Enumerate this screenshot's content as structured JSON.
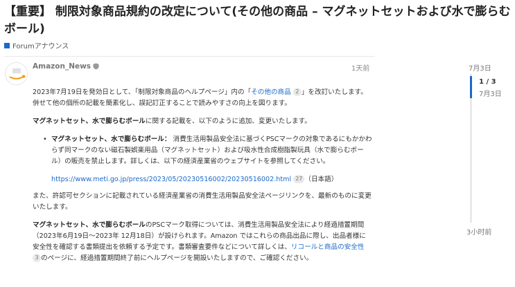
{
  "topic": {
    "title": "【重要】 制限対象商品規約の改定について(その他の商品 – マグネットセットおよび水で膨らむボール)",
    "category": "Forumアナウンス"
  },
  "post": {
    "author": "Amazon_News",
    "date": "1天前",
    "p1": {
      "a": "2023年7月19日を発効日として、「制限対象商品のヘルプページ」内の「",
      "link": "その他の商品",
      "badge": "2",
      "b": "」を改訂いたします。併せて他の個所の記載を簡素化し、誤記訂正することで読みやすさの向上を図ります。"
    },
    "p2": {
      "bold": "マグネットセット、水で膨らむボール",
      "rest": "に関する記載を、以下のように追加、変更いたします。"
    },
    "bullet": {
      "bold": "マグネットセット、水で膨らむボール：",
      "rest": " 消費生活用製品安全法に基づくPSCマークの対象であるにもかかわらず同マークのない磁石製娯楽用品（マグネットセット）および吸水性合成樹脂製玩具（水で膨らむボール）の販売を禁止します。詳しくは、以下の経済産業省のウェブサイトを参照してください。"
    },
    "meti": {
      "url": "https://www.meti.go.jp/press/2023/05/20230516002/20230516002.html",
      "badge": "27",
      "suffix": "（日本語）"
    },
    "p3": "また、許認可セクションに記載されている経済産業省の消費生活用製品安全法ページリンクを、最新のものに変更いたします。",
    "p4": {
      "bold": "マグネットセット、水で膨らむボール",
      "a": "のPSCマーク取得については、消費生活用製品安全法により経過措置期間（2023年6月19日～2023年 12月18日）が設けられます。Amazon ではこれらの商品出品に際し、出品者様に安全性を確認する書類提出を依頼する予定です。書類審査要件などについて詳しくは、",
      "link": "リコールと商品の安全性",
      "badge": "3",
      "b": "のページに、経過措置期間終了前にヘルプページを開設いたしますので、ご確認ください。"
    }
  },
  "timeline": {
    "top_date": "7月3日",
    "count": "1 / 3",
    "handle_date": "7月3日",
    "bottom_label": "3小时前"
  },
  "colors": {
    "accent": "#1b6ac9",
    "text": "#222222",
    "muted": "#777777"
  },
  "icons": {
    "moderator": "shield-icon",
    "category": "category-badge-icon"
  }
}
